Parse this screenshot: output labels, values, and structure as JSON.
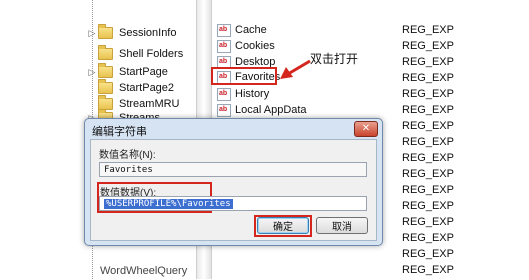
{
  "tree": {
    "items": [
      {
        "label": "SessionInfo",
        "expander": "▷"
      },
      {
        "label": "Shell Folders",
        "expander": ""
      },
      {
        "label": "StartPage",
        "expander": "▷"
      },
      {
        "label": "StartPage2",
        "expander": ""
      },
      {
        "label": "StreamMRU",
        "expander": ""
      },
      {
        "label": "Streams",
        "expander": "▷"
      }
    ],
    "bottom_partial": "WordWheelQuery"
  },
  "values": [
    {
      "name": "Cache",
      "type": "REG_EXP"
    },
    {
      "name": "Cookies",
      "type": "REG_EXP"
    },
    {
      "name": "Desktop",
      "type": "REG_EXP"
    },
    {
      "name": "Favorites",
      "type": "REG_EXP"
    },
    {
      "name": "History",
      "type": "REG_EXP"
    },
    {
      "name": "Local AppData",
      "type": "REG_EXP"
    }
  ],
  "extra_types": [
    "REG_EXP",
    "REG_EXP",
    "REG_EXP",
    "REG_EXP",
    "REG_EXP",
    "REG_EXP",
    "REG_EXP",
    "REG_EXP",
    "REG_EXP",
    "REG_EXP"
  ],
  "annotation": "双击打开",
  "dialog": {
    "title": "编辑字符串",
    "close": "✕",
    "name_label": "数值名称(N):",
    "name_value": "Favorites",
    "data_label": "数值数据(V):",
    "data_value": "%USERPROFILE%\\Favorites",
    "ok": "确定",
    "cancel": "取消"
  }
}
